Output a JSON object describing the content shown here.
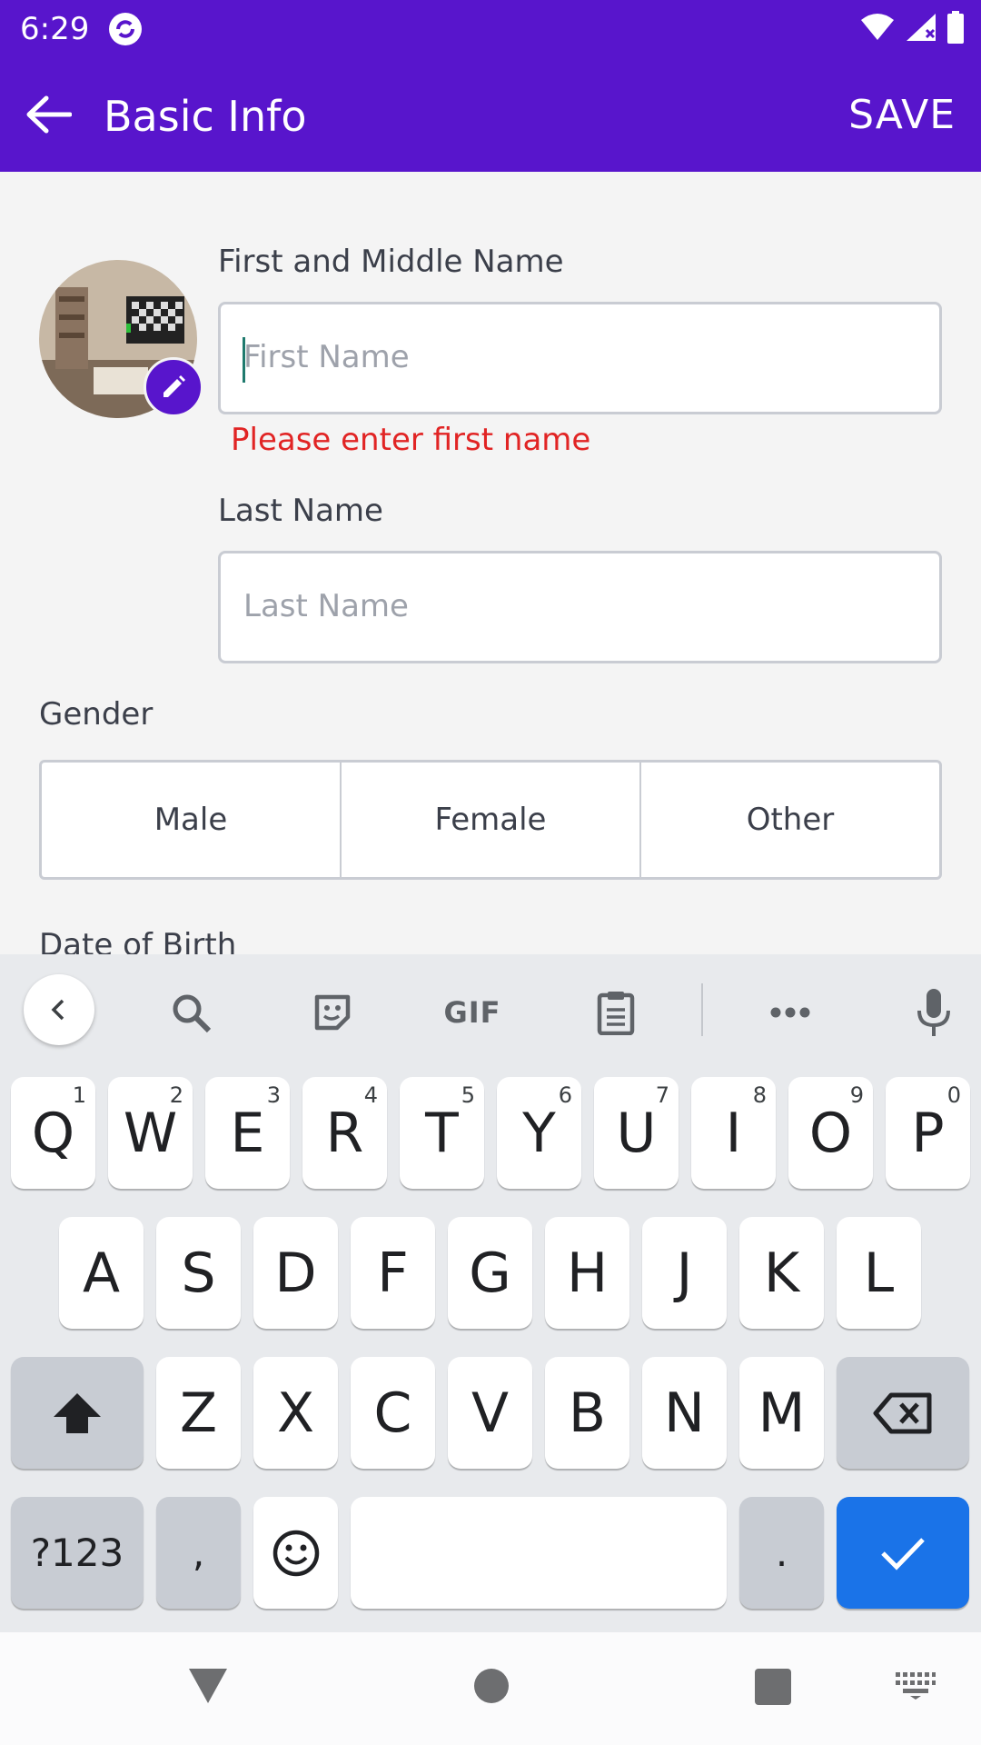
{
  "status_bar": {
    "time": "6:29"
  },
  "app_bar": {
    "title": "Basic Info",
    "save_label": "SAVE"
  },
  "form": {
    "first_name": {
      "label": "First and Middle Name",
      "placeholder": "First Name",
      "value": "",
      "error": "Please enter first name"
    },
    "last_name": {
      "label": "Last Name",
      "placeholder": "Last Name",
      "value": ""
    },
    "gender": {
      "label": "Gender",
      "options": [
        "Male",
        "Female",
        "Other"
      ]
    },
    "dob": {
      "label": "Date of Birth"
    }
  },
  "keyboard": {
    "toolbar": {
      "gif_label": "GIF"
    },
    "row1": [
      {
        "key": "Q",
        "hint": "1"
      },
      {
        "key": "W",
        "hint": "2"
      },
      {
        "key": "E",
        "hint": "3"
      },
      {
        "key": "R",
        "hint": "4"
      },
      {
        "key": "T",
        "hint": "5"
      },
      {
        "key": "Y",
        "hint": "6"
      },
      {
        "key": "U",
        "hint": "7"
      },
      {
        "key": "I",
        "hint": "8"
      },
      {
        "key": "O",
        "hint": "9"
      },
      {
        "key": "P",
        "hint": "0"
      }
    ],
    "row2": [
      "A",
      "S",
      "D",
      "F",
      "G",
      "H",
      "J",
      "K",
      "L"
    ],
    "row3": [
      "Z",
      "X",
      "C",
      "V",
      "B",
      "N",
      "M"
    ],
    "symbols_label": "?123",
    "comma_label": ",",
    "period_label": "."
  },
  "colors": {
    "primary": "#5815cc",
    "error": "#e12424",
    "keyboard_action": "#1a73e8"
  }
}
